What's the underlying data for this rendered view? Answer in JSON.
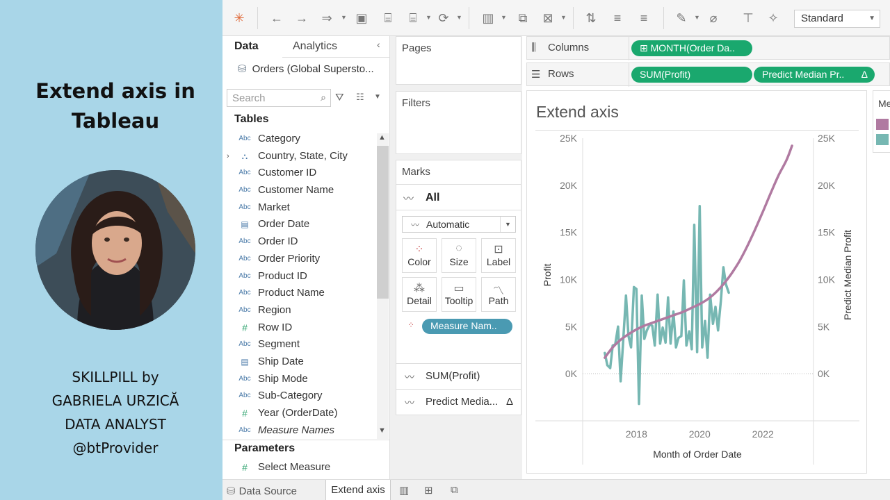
{
  "promo": {
    "title_line1": "Extend axis in",
    "title_line2": "Tableau",
    "credit_line1": "SKILLPILL by",
    "credit_line2": "GABRIELA URZICĂ",
    "credit_line3": "DATA ANALYST",
    "credit_line4": "@btProvider"
  },
  "toolbar": {
    "view_size": "Standard"
  },
  "data_pane": {
    "tab_data": "Data",
    "tab_analytics": "Analytics",
    "datasource": "Orders (Global Supersto...",
    "search_placeholder": "Search",
    "tables_heading": "Tables",
    "fields": [
      {
        "type": "abc",
        "name": "Category"
      },
      {
        "type": "geo",
        "name": "Country, State, City"
      },
      {
        "type": "abc",
        "name": "Customer ID"
      },
      {
        "type": "abc",
        "name": "Customer Name"
      },
      {
        "type": "abc",
        "name": "Market"
      },
      {
        "type": "date",
        "name": "Order Date"
      },
      {
        "type": "abc",
        "name": "Order ID"
      },
      {
        "type": "abc",
        "name": "Order Priority"
      },
      {
        "type": "abc",
        "name": "Product ID"
      },
      {
        "type": "abc",
        "name": "Product Name"
      },
      {
        "type": "abc",
        "name": "Region"
      },
      {
        "type": "num",
        "name": "Row ID"
      },
      {
        "type": "abc",
        "name": "Segment"
      },
      {
        "type": "date",
        "name": "Ship Date"
      },
      {
        "type": "abc",
        "name": "Ship Mode"
      },
      {
        "type": "abc",
        "name": "Sub-Category"
      },
      {
        "type": "num",
        "name": "Year (OrderDate)"
      },
      {
        "type": "abc",
        "name": "Measure Names"
      }
    ],
    "parameters_heading": "Parameters",
    "parameter": "Select Measure"
  },
  "cards": {
    "pages": "Pages",
    "filters": "Filters",
    "marks": "Marks",
    "marks_all": "All",
    "mark_type": "Automatic",
    "buttons": {
      "color": "Color",
      "size": "Size",
      "label": "Label",
      "detail": "Detail",
      "tooltip": "Tooltip",
      "path": "Path"
    },
    "measure_pill": "Measure Nam..",
    "row_profit": "SUM(Profit)",
    "row_predict": "Predict Media...",
    "delta": "Δ"
  },
  "shelves": {
    "columns_label": "Columns",
    "rows_label": "Rows",
    "columns_pill": "⊞ MONTH(Order Da..",
    "rows_pill_1": "SUM(Profit)",
    "rows_pill_2": "Predict Median Pr..",
    "delta": "Δ"
  },
  "legend": {
    "title": "Me"
  },
  "bottom_tabs": {
    "data_source": "Data Source",
    "sheet": "Extend axis"
  },
  "chart_data": {
    "type": "line",
    "title": "Extend axis",
    "xlabel": "Month of Order Date",
    "ylabel_left": "Profit",
    "ylabel_right": "Predict Median Profit",
    "ylim": [
      -5000,
      25000
    ],
    "y_ticks": [
      0,
      5000,
      10000,
      15000,
      20000,
      25000
    ],
    "y_tick_labels": [
      "0K",
      "5K",
      "10K",
      "15K",
      "20K",
      "25K"
    ],
    "x_ticks": [
      2018,
      2020,
      2022
    ],
    "x_tick_labels": [
      "2018",
      "2020",
      "2022"
    ],
    "xlim": [
      2016.3,
      2023.6
    ],
    "series": [
      {
        "name": "SUM(Profit)",
        "color": "#76b7b2",
        "points": [
          [
            2017.0,
            2200
          ],
          [
            2017.08,
            900
          ],
          [
            2017.17,
            600
          ],
          [
            2017.25,
            3000
          ],
          [
            2017.33,
            3100
          ],
          [
            2017.42,
            5000
          ],
          [
            2017.5,
            -800
          ],
          [
            2017.58,
            3400
          ],
          [
            2017.67,
            8300
          ],
          [
            2017.75,
            4000
          ],
          [
            2017.83,
            2800
          ],
          [
            2017.92,
            9200
          ],
          [
            2018.0,
            9000
          ],
          [
            2018.08,
            -3200
          ],
          [
            2018.17,
            8300
          ],
          [
            2018.25,
            3700
          ],
          [
            2018.33,
            4600
          ],
          [
            2018.42,
            5200
          ],
          [
            2018.5,
            5100
          ],
          [
            2018.58,
            3000
          ],
          [
            2018.67,
            8400
          ],
          [
            2018.75,
            3200
          ],
          [
            2018.83,
            4900
          ],
          [
            2018.92,
            3300
          ],
          [
            2019.0,
            8100
          ],
          [
            2019.08,
            3200
          ],
          [
            2019.17,
            6600
          ],
          [
            2019.25,
            2800
          ],
          [
            2019.33,
            3800
          ],
          [
            2019.42,
            4000
          ],
          [
            2019.5,
            9900
          ],
          [
            2019.58,
            3000
          ],
          [
            2019.67,
            4500
          ],
          [
            2019.75,
            2600
          ],
          [
            2019.83,
            15800
          ],
          [
            2019.92,
            2300
          ],
          [
            2020.0,
            17800
          ],
          [
            2020.08,
            2800
          ],
          [
            2020.17,
            5600
          ],
          [
            2020.25,
            1700
          ],
          [
            2020.33,
            8400
          ],
          [
            2020.42,
            5300
          ],
          [
            2020.5,
            7100
          ],
          [
            2020.58,
            4600
          ],
          [
            2020.67,
            7700
          ],
          [
            2020.75,
            11300
          ],
          [
            2020.83,
            9500
          ],
          [
            2020.92,
            8600
          ]
        ]
      },
      {
        "name": "Predict Median Profit",
        "color": "#b07aa1",
        "points": [
          [
            2017.0,
            1700
          ],
          [
            2017.25,
            2800
          ],
          [
            2017.5,
            3600
          ],
          [
            2017.75,
            4200
          ],
          [
            2018.0,
            4700
          ],
          [
            2018.25,
            5100
          ],
          [
            2018.5,
            5400
          ],
          [
            2018.75,
            5700
          ],
          [
            2019.0,
            6000
          ],
          [
            2019.25,
            6300
          ],
          [
            2019.5,
            6600
          ],
          [
            2019.75,
            7000
          ],
          [
            2020.0,
            7400
          ],
          [
            2020.25,
            7900
          ],
          [
            2020.5,
            8600
          ],
          [
            2020.75,
            9500
          ],
          [
            2021.0,
            10600
          ],
          [
            2021.25,
            11900
          ],
          [
            2021.5,
            13500
          ],
          [
            2021.75,
            15300
          ],
          [
            2022.0,
            17200
          ],
          [
            2022.25,
            19200
          ],
          [
            2022.5,
            21100
          ],
          [
            2022.75,
            22700
          ],
          [
            2022.92,
            24200
          ]
        ]
      }
    ]
  }
}
